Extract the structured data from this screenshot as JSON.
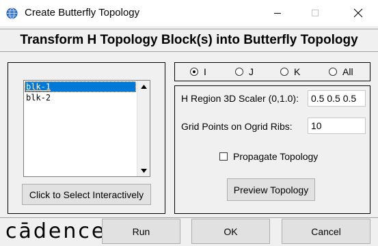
{
  "window": {
    "title": "Create Butterfly Topology",
    "app_icon": "globe-icon",
    "controls": [
      "minimize-icon",
      "maximize-icon",
      "close-icon"
    ]
  },
  "heading": "Transform H Topology Block(s) into Butterfly Topology",
  "block_list": {
    "items": [
      "blk-1",
      "blk-2"
    ],
    "selected": "blk-1"
  },
  "select_button_label": "Click to Select Interactively",
  "direction": {
    "options": [
      "I",
      "J",
      "K",
      "All"
    ],
    "selected": "I"
  },
  "fields": {
    "scaler": {
      "label": "H Region 3D Scaler (0,1.0):",
      "value": "0.5 0.5 0.5"
    },
    "ribs": {
      "label": "Grid Points on Ogrid Ribs:",
      "value": "10"
    }
  },
  "propagate": {
    "label": "Propagate Topology",
    "checked": false
  },
  "preview_button_label": "Preview Topology",
  "footer": {
    "logo_text": "cādence",
    "run_label": "Run",
    "ok_label": "OK",
    "cancel_label": "Cancel"
  },
  "colors": {
    "selection": "#0078d7",
    "button_face": "#e1e1e1"
  }
}
